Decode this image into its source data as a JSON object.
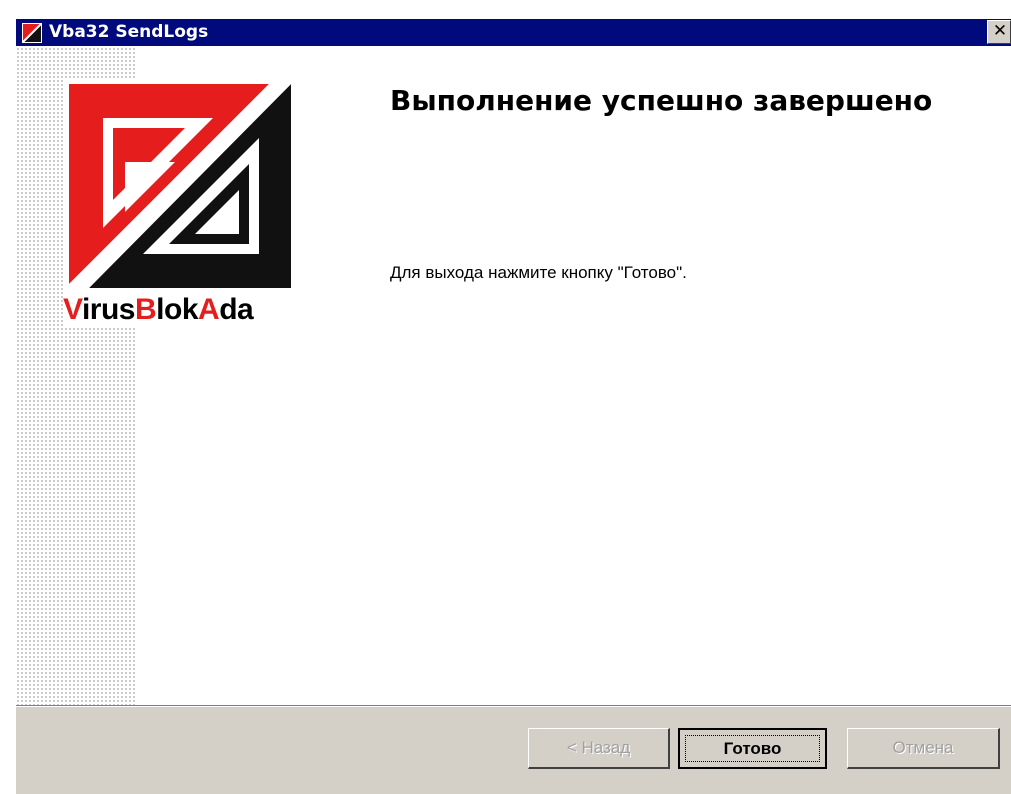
{
  "window": {
    "title": "Vba32 SendLogs",
    "close_label": "✕"
  },
  "brand": {
    "logo_text_parts": [
      "V",
      "irus",
      "B",
      "lok",
      "A",
      "da"
    ],
    "colors": {
      "red": "#e51d1d",
      "black": "#111111",
      "titlebar": "#000a7c",
      "face": "#d4d0c8"
    }
  },
  "content": {
    "heading": "Выполнение успешно завершено",
    "message": "Для выхода нажмите кнопку \"Готово\"."
  },
  "buttons": {
    "back": {
      "label": "< Назад",
      "enabled": false
    },
    "finish": {
      "label": "Готово",
      "enabled": true,
      "default": true
    },
    "cancel": {
      "label": "Отмена",
      "enabled": false
    }
  }
}
